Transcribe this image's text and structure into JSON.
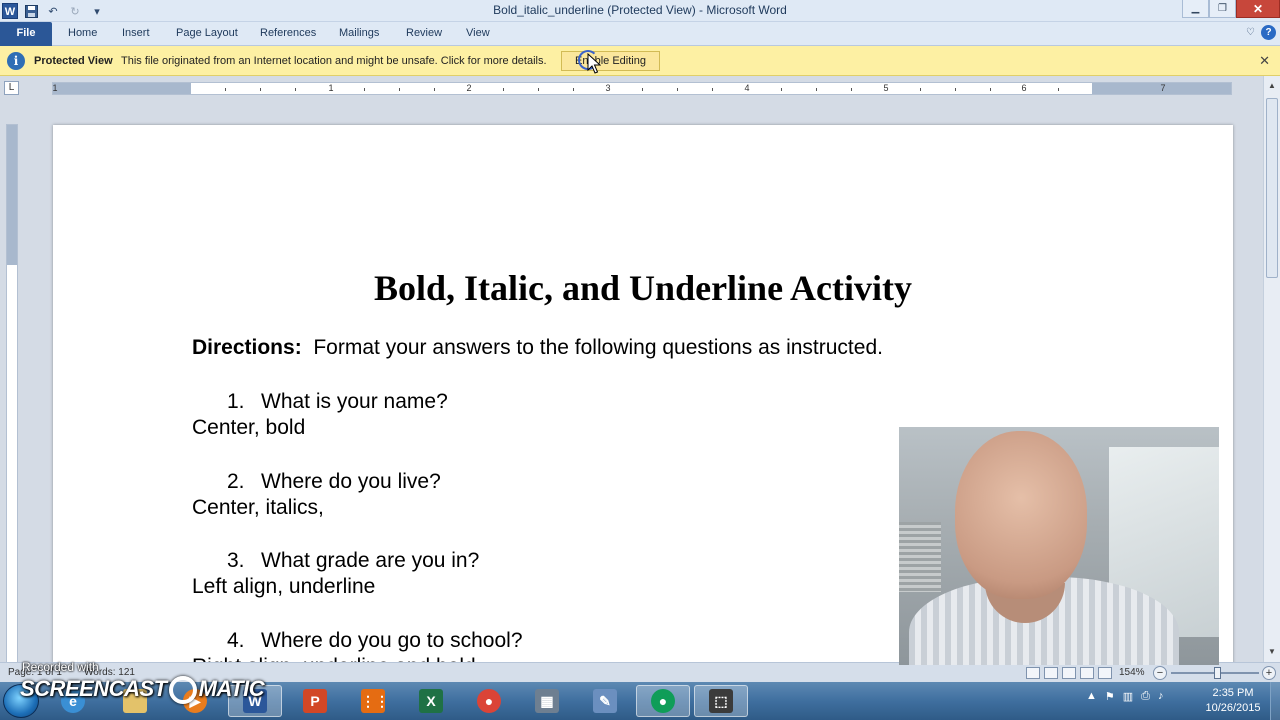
{
  "window": {
    "title": "Bold_italic_underline (Protected View)  -  Microsoft Word",
    "app_icon": "W",
    "minimize_icon": "minimize-icon",
    "maximize_icon": "maximize-icon",
    "close_icon": "close-icon"
  },
  "ribbon": {
    "tabs": [
      "File",
      "Home",
      "Insert",
      "Page Layout",
      "References",
      "Mailings",
      "Review",
      "View"
    ],
    "help_icon": "?"
  },
  "protected_view": {
    "label": "Protected View",
    "message": "This file originated from an Internet location and might be unsafe. Click for more details.",
    "button": "Enable Editing",
    "close": "✕"
  },
  "ruler": {
    "corner": "L",
    "numbers": [
      "1",
      "1",
      "2",
      "3",
      "4",
      "5",
      "6",
      "7"
    ]
  },
  "document": {
    "title": "Bold, Italic, and Underline Activity",
    "directions_label": "Directions:",
    "directions_text": "Format your answers to the following questions as instructed.",
    "questions": [
      {
        "num": "1.",
        "text": "What is your name?",
        "instruction": "Center, bold"
      },
      {
        "num": "2.",
        "text": "Where do you live?",
        "instruction": "Center, italics,"
      },
      {
        "num": "3.",
        "text": "What grade are you in?",
        "instruction": "Left align, underline"
      },
      {
        "num": "4.",
        "text": "Where do you go to school?",
        "instruction": "Right align, underline and bold"
      }
    ]
  },
  "status": {
    "page": "Page: 1 of 1",
    "words": "Words: 121",
    "zoom": "154%",
    "zoom_minus": "−",
    "zoom_plus": "+"
  },
  "watermark": {
    "recorded_with": "Recorded with",
    "logo_left": "SCREENCAST",
    "logo_right": "MATIC"
  },
  "taskbar": {
    "apps": [
      {
        "name": "word",
        "glyph": "W",
        "color": "#2b579a"
      },
      {
        "name": "powerpoint",
        "glyph": "P",
        "color": "#d24726"
      },
      {
        "name": "apps",
        "glyph": "⋮⋮",
        "color": "#e56c12"
      },
      {
        "name": "excel",
        "glyph": "X",
        "color": "#1f7145"
      },
      {
        "name": "chrome",
        "glyph": "●",
        "color": "#db4437"
      },
      {
        "name": "calculator",
        "glyph": "▦",
        "color": "#6e7f91"
      },
      {
        "name": "paint",
        "glyph": "✎",
        "color": "#6b8fbf"
      },
      {
        "name": "chrome-2",
        "glyph": "●",
        "color": "#0f9d58"
      },
      {
        "name": "snipping",
        "glyph": "⬚",
        "color": "#3b3b3b"
      }
    ],
    "time": "2:35 PM",
    "date": "10/26/2015"
  },
  "colors": {
    "file_tab": "#2b5797",
    "protected_bar": "#fdf0a3",
    "title_bar": "#dfe9f5"
  }
}
